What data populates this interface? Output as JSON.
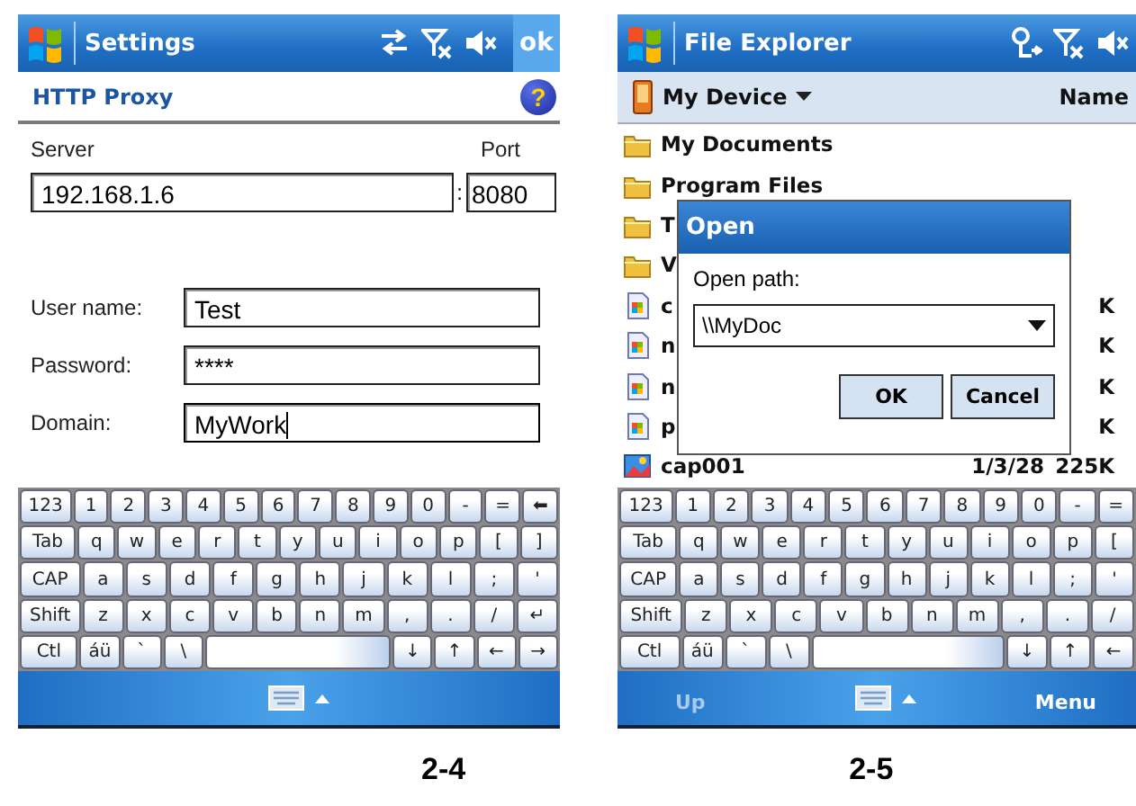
{
  "settings_screen": {
    "title": "Settings",
    "ok_button": "ok",
    "page_title": "HTTP Proxy",
    "help_button": "?",
    "server_label": "Server",
    "port_label": "Port",
    "server_value": "192.168.1.6",
    "port_separator": ":",
    "port_value": "8080",
    "fields": [
      {
        "label": "User name:",
        "value": "Test",
        "focused": false
      },
      {
        "label": "Password:",
        "value": "****",
        "focused": false
      },
      {
        "label": "Domain:",
        "value": "MyWork",
        "focused": true
      }
    ],
    "keyboard": [
      {
        "keys": [
          "123",
          "1",
          "2",
          "3",
          "4",
          "5",
          "6",
          "7",
          "8",
          "9",
          "0",
          "-",
          "=",
          "⬅"
        ]
      },
      {
        "keys": [
          "Tab",
          "q",
          "w",
          "e",
          "r",
          "t",
          "y",
          "u",
          "i",
          "o",
          "p",
          "[",
          "]"
        ]
      },
      {
        "keys": [
          "CAP",
          "a",
          "s",
          "d",
          "f",
          "g",
          "h",
          "j",
          "k",
          "l",
          ";",
          "'"
        ]
      },
      {
        "keys": [
          "Shift",
          "z",
          "x",
          "c",
          "v",
          "b",
          "n",
          "m",
          ",",
          ".",
          "/",
          "↵"
        ]
      },
      {
        "keys": [
          "Ctl",
          "áü",
          "`",
          "\\"
        ],
        "after_space": [
          "↓",
          "↑",
          "←",
          "→"
        ]
      }
    ]
  },
  "file_explorer_screen": {
    "title": "File Explorer",
    "location": "My Device",
    "sort_label": "Name",
    "files": [
      {
        "kind": "folder",
        "name": "My Documents"
      },
      {
        "kind": "folder",
        "name": "Program Files"
      },
      {
        "kind": "folder",
        "name": "T"
      },
      {
        "kind": "folder",
        "name": "V"
      },
      {
        "kind": "program",
        "name": "c",
        "size": "K"
      },
      {
        "kind": "program",
        "name": "n",
        "size": "K"
      },
      {
        "kind": "program",
        "name": "n",
        "size": "K"
      },
      {
        "kind": "program",
        "name": "p",
        "size": "K"
      },
      {
        "kind": "image",
        "name": "cap001",
        "date": "1/3/28",
        "size": "225K"
      }
    ],
    "dialog": {
      "title": "Open",
      "label": "Open path:",
      "value": "\\\\MyDoc",
      "buttons": [
        "OK",
        "Cancel"
      ]
    },
    "keyboard": [
      {
        "keys": [
          "123",
          "1",
          "2",
          "3",
          "4",
          "5",
          "6",
          "7",
          "8",
          "9",
          "0",
          "-",
          "="
        ]
      },
      {
        "keys": [
          "Tab",
          "q",
          "w",
          "e",
          "r",
          "t",
          "y",
          "u",
          "i",
          "o",
          "p",
          "["
        ]
      },
      {
        "keys": [
          "CAP",
          "a",
          "s",
          "d",
          "f",
          "g",
          "h",
          "j",
          "k",
          "l",
          ";",
          "'"
        ]
      },
      {
        "keys": [
          "Shift",
          "z",
          "x",
          "c",
          "v",
          "b",
          "n",
          "m",
          ",",
          ".",
          "/"
        ]
      },
      {
        "keys": [
          "Ctl",
          "áü",
          "`",
          "\\"
        ],
        "after_space": [
          "↓",
          "↑",
          "←"
        ]
      }
    ],
    "softkeys": [
      {
        "label": "Up",
        "disabled": true
      },
      {
        "label": "Menu",
        "disabled": false
      }
    ]
  },
  "captions": [
    "2-4",
    "2-5"
  ]
}
